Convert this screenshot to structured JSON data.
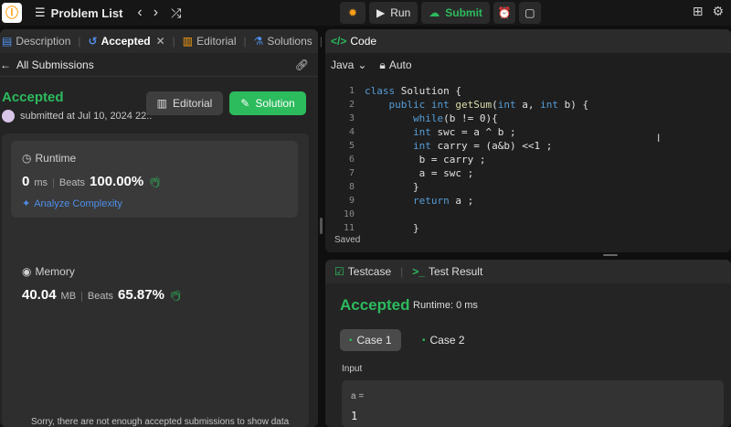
{
  "topbar": {
    "problem_list": "Problem List",
    "run": "Run",
    "submit": "Submit"
  },
  "left": {
    "tabs": [
      {
        "label": "Description"
      },
      {
        "label": "Accepted"
      },
      {
        "label": "Editorial"
      },
      {
        "label": "Solutions"
      }
    ],
    "all_submissions": "All Submissions",
    "status": "Accepted",
    "submitted_at": "submitted at Jul 10, 2024 22::",
    "editorial_btn": "Editorial",
    "solution_btn": "Solution",
    "runtime": {
      "label": "Runtime",
      "value": "0",
      "unit": "ms",
      "beats_label": "Beats",
      "beats_value": "100.00%",
      "analyze": "Analyze Complexity"
    },
    "memory": {
      "label": "Memory",
      "value": "40.04",
      "unit": "MB",
      "beats_label": "Beats",
      "beats_value": "65.87%"
    },
    "no_data": "Sorry, there are not enough accepted submissions to show data"
  },
  "code": {
    "header": "Code",
    "language": "Java",
    "auto": "Auto",
    "lines": [
      {
        "n": "1",
        "t": "class Solution {"
      },
      {
        "n": "2",
        "t": "    public int getSum(int a, int b) {"
      },
      {
        "n": "3",
        "t": "        while(b != 0){"
      },
      {
        "n": "4",
        "t": "        int swc = a ^ b ;"
      },
      {
        "n": "5",
        "t": "        int carry = (a&b) <<1 ;"
      },
      {
        "n": "6",
        "t": "         b = carry ;"
      },
      {
        "n": "7",
        "t": "         a = swc ;"
      },
      {
        "n": "8",
        "t": "        }"
      },
      {
        "n": "9",
        "t": "        return a ;"
      },
      {
        "n": "10",
        "t": ""
      },
      {
        "n": "11",
        "t": "        }"
      }
    ],
    "saved": "Saved"
  },
  "test": {
    "tab_testcase": "Testcase",
    "tab_result": "Test Result",
    "status": "Accepted",
    "runtime": "Runtime: 0 ms",
    "case1": "Case 1",
    "case2": "Case 2",
    "input_label": "Input",
    "var_name": "a =",
    "var_value": "1"
  },
  "colors": {
    "accent_green": "#2cbb5d",
    "link_blue": "#4f8fe9",
    "brand_orange": "#ffa116"
  }
}
